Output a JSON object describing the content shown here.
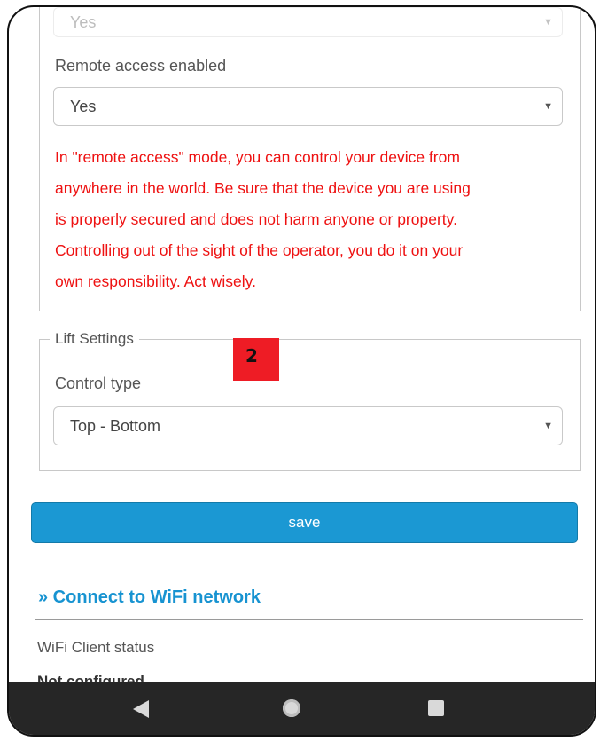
{
  "remote_section": {
    "prev_select_value": "Yes",
    "remote_access_label": "Remote access enabled",
    "remote_access_value": "Yes",
    "warning_lines": [
      "In \"remote access\" mode, you can control your device from",
      "anywhere in the world. Be sure that the device you are using",
      "is properly secured and does not harm anyone or property.",
      "Controlling out of the sight of the operator, you do it on your",
      "own responsibility. Act wisely."
    ]
  },
  "lift_settings": {
    "legend": "Lift Settings",
    "control_type_label": "Control type",
    "control_type_value": "Top - Bottom"
  },
  "annotation_badge": "2",
  "save_label": "save",
  "wifi": {
    "section_title": "» Connect to WiFi network",
    "status_label": "WiFi Client status",
    "status_value": "Not configured"
  },
  "icons": {
    "select_arrow": "▼"
  },
  "colors": {
    "warning": "#ee1111",
    "accent": "#1b98d3",
    "badge": "#ee1c25"
  }
}
